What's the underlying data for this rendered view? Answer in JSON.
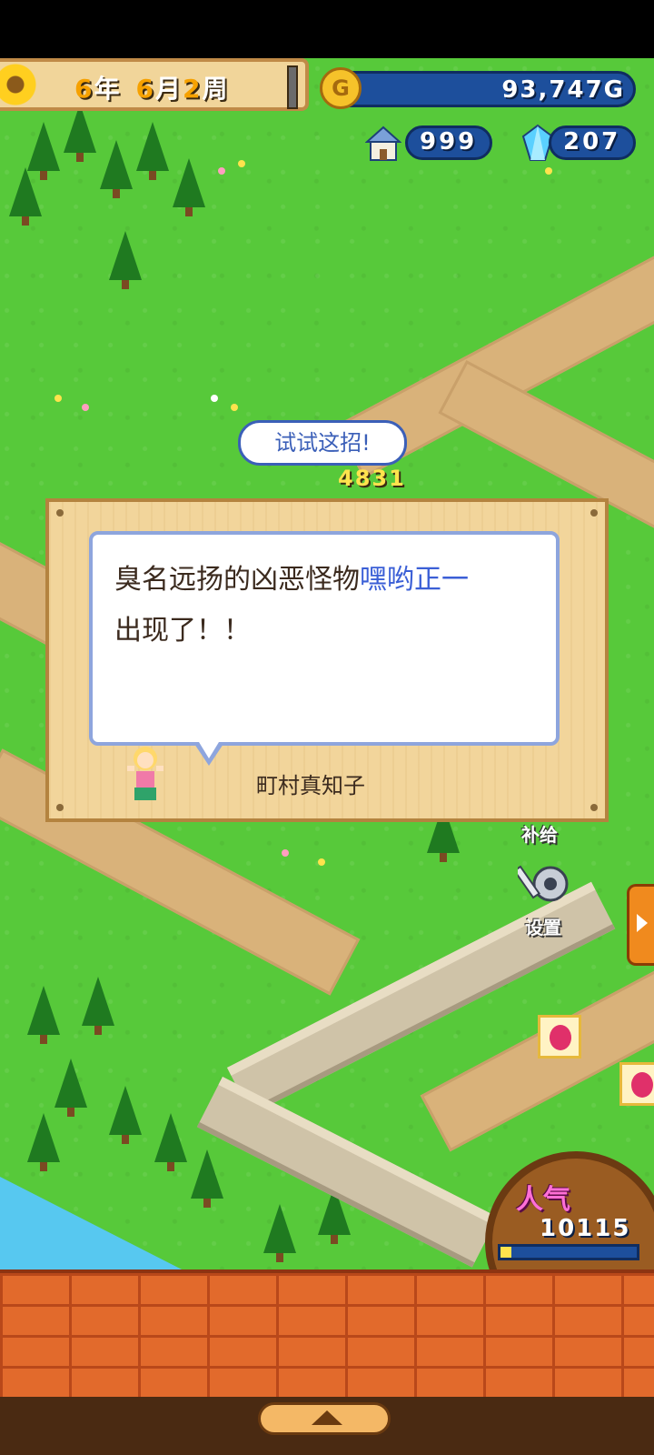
{
  "hud": {
    "year_num": "6",
    "year_unit": "年",
    "month_num": "6",
    "month_unit": "月",
    "week_num": "2",
    "week_unit": "周",
    "money": "93,747G",
    "coin_letter": "G",
    "houses": "999",
    "crystals": "207"
  },
  "battle": {
    "speech": "试试这招!",
    "damage": "4831"
  },
  "dialog": {
    "text_part1": "臭名远扬的凶恶怪物",
    "text_highlight": "嘿哟正一",
    "text_part2": "出现了！！",
    "speaker": "町村真知子"
  },
  "side": {
    "supply_label": "补给",
    "settings_label": "设置"
  },
  "popularity": {
    "label": "人气",
    "value": "10115",
    "level": 0.08
  }
}
